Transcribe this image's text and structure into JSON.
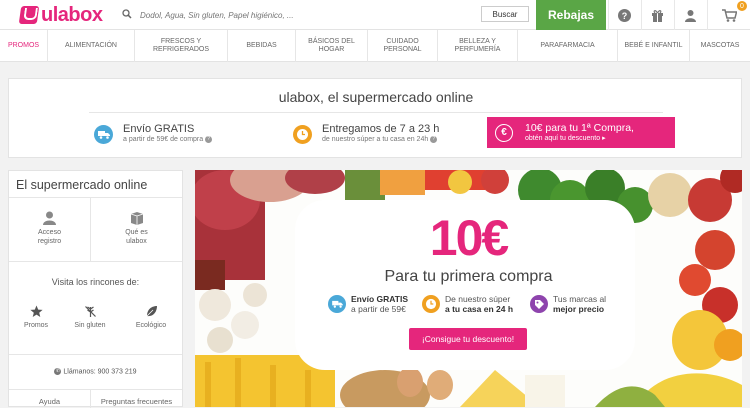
{
  "header": {
    "logo_text": "ulabox",
    "search_placeholder": "Dodol, Agua, Sin gluten, Papel higiénico, ...",
    "search_button": "Buscar",
    "sale_button": "Rebajas",
    "cart_count": "0",
    "icons": [
      "help-icon",
      "gift-icon",
      "user-icon",
      "cart-icon"
    ]
  },
  "nav": {
    "categories": [
      "PROMOS",
      "ALIMENTACIÓN",
      "FRESCOS Y REFRIGERADOS",
      "BEBIDAS",
      "BÁSICOS DEL HOGAR",
      "CUIDADO PERSONAL",
      "BELLEZA Y PERFUMERÍA",
      "PARAFARMACIA",
      "BEBÉ E INFANTIL",
      "MASCOTAS"
    ]
  },
  "welcome": {
    "title": "ulabox, el supermercado online",
    "shipping_main": "Envío GRATIS",
    "shipping_sub": "a partir de 59€ de compra",
    "delivery_main": "Entregamos de 7 a 23 h",
    "delivery_sub": "de nuestro súper a tu casa en 24h",
    "promo_symbol": "€",
    "promo_main": "10€ para tu 1ª Compra,",
    "promo_sub": "obtén aquí tu descuento"
  },
  "sidebar": {
    "title": "El supermercado online",
    "access_label_1": "Acceso",
    "access_label_2": "registro",
    "what_label_1": "Qué es",
    "what_label_2": "ulabox",
    "corners_title": "Visita los rincones de:",
    "corner_promos": "Promos",
    "corner_gluten": "Sin gluten",
    "corner_eco": "Ecológico",
    "phone": "Llámanos: 900 373 219",
    "footer_help": "Ayuda",
    "footer_faq": "Preguntas frecuentes"
  },
  "hero": {
    "big": "10€",
    "sub": "Para tu primera compra",
    "feat1_line1": "Envío GRATIS",
    "feat1_line2": "a partir de 59€",
    "feat2_line1": "De nuestro súper",
    "feat2_line2": "a tu casa en 24 h",
    "feat3_line1": "Tus marcas al",
    "feat3_line2": "mejor precio",
    "button": "¡Consigue tu descuento!"
  },
  "colors": {
    "brand_pink": "#e5267c",
    "sale_green": "#5aa646",
    "shipping_blue": "#4aa8d8",
    "delivery_orange": "#f0a020",
    "brands_purple": "#8e44ad"
  }
}
